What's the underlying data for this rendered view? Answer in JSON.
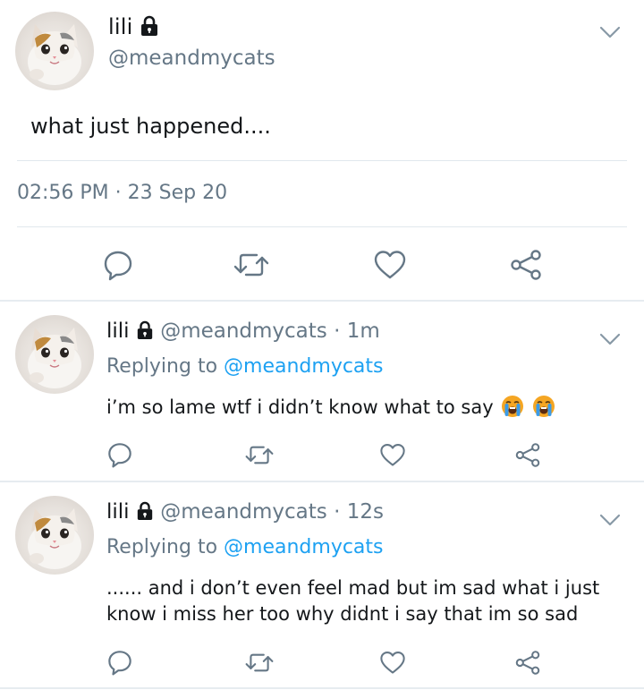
{
  "main_tweet": {
    "display_name": "lili",
    "handle": "@meandmycats",
    "text": "what just happened....",
    "timestamp": "02:56 PM · 23 Sep 20",
    "icons": [
      "lock-icon",
      "chevron-down-icon",
      "reply-icon",
      "retweet-icon",
      "like-icon",
      "share-icon"
    ]
  },
  "replies": [
    {
      "display_name": "lili",
      "handle_time": "@meandmycats · 1m",
      "replying_prefix": "Replying to ",
      "replying_to": "@meandmycats",
      "text": "i’m so lame wtf i didn’t know what to say",
      "emoji": [
        "loudly-crying-face-icon",
        "loudly-crying-face-icon"
      ]
    },
    {
      "display_name": "lili",
      "handle_time": "@meandmycats · 12s",
      "replying_prefix": "Replying to ",
      "replying_to": "@meandmycats",
      "text": "...... and i don’t even feel mad but im sad what i just know i miss her too why didnt i say that im so sad"
    }
  ],
  "colors": {
    "text": "#14171a",
    "secondary": "#657786",
    "link": "#1da1f2",
    "divider": "#e1e8ed"
  }
}
